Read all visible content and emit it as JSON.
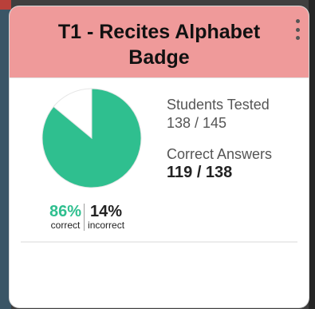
{
  "card": {
    "title": "T1 - Recites Alphabet Badge",
    "header_color": "#ef9a9a",
    "menu_icon": "vertical-ellipsis-icon"
  },
  "chart_data": {
    "type": "pie",
    "slices": [
      {
        "label": "correct",
        "value": 86,
        "color": "#2fbf8f"
      },
      {
        "label": "incorrect",
        "value": 14,
        "color": "#ffffff"
      }
    ]
  },
  "percentages": {
    "correct_value": "86%",
    "correct_label": "correct",
    "incorrect_value": "14%",
    "incorrect_label": "incorrect"
  },
  "stats": {
    "students_tested_label": "Students Tested",
    "students_tested_value": "138 / 145",
    "correct_answers_label": "Correct Answers",
    "correct_answers_value": "119 / 138"
  }
}
